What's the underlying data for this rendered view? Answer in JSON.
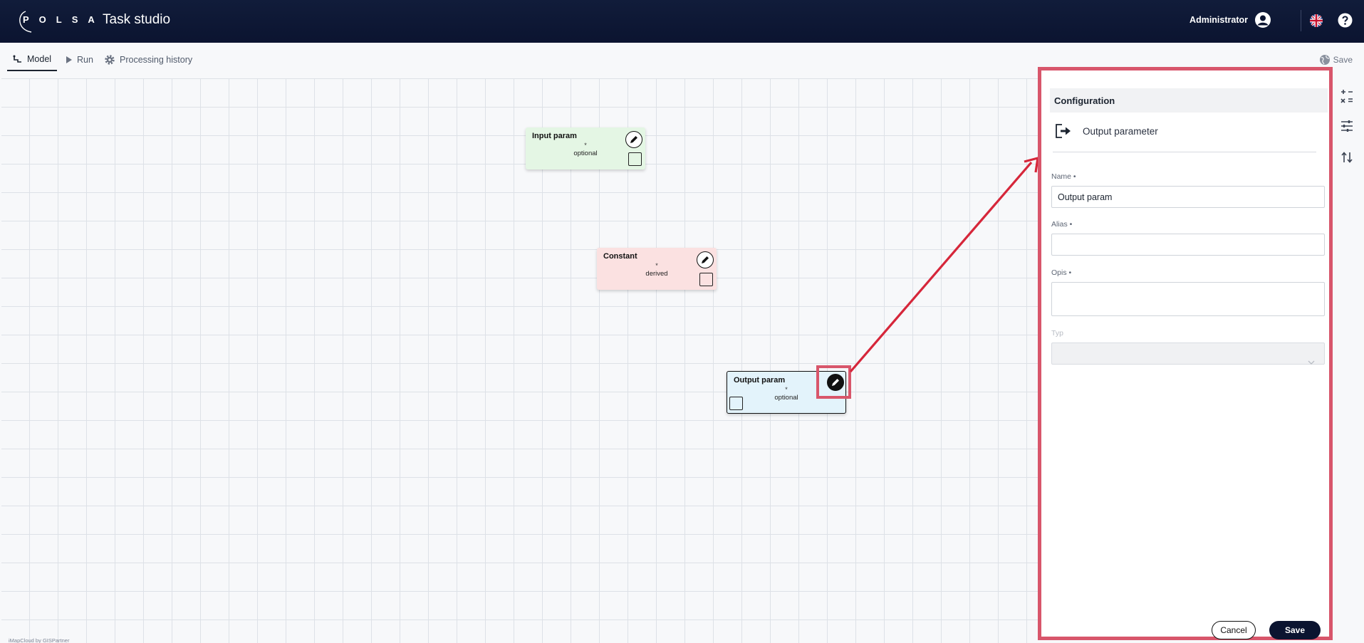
{
  "header": {
    "logo_text": "POLSA",
    "app_title": "Task studio",
    "user_name": "Administrator",
    "user_icon": "account-circle-icon",
    "language_icon": "uk-flag-icon",
    "help_icon": "help-icon"
  },
  "toolbar": {
    "tabs": [
      {
        "label": "Model",
        "icon": "flow-icon",
        "active": true
      },
      {
        "label": "Run",
        "icon": "play-icon",
        "active": false
      },
      {
        "label": "Processing history",
        "icon": "gear-icon",
        "active": false
      }
    ],
    "save_label": "Save",
    "save_icon": "globe-icon"
  },
  "canvas": {
    "nodes": [
      {
        "title": "Input param",
        "marker": "*",
        "subtitle": "optional",
        "color": "#e4f6e4"
      },
      {
        "title": "Constant",
        "marker": "*",
        "subtitle": "derived",
        "color": "#fbe1e1"
      },
      {
        "title": "Output param",
        "marker": "*",
        "subtitle": "optional",
        "color": "#e3f3fb"
      }
    ],
    "footer_credit": "iMapCloud by GISPartner"
  },
  "panel": {
    "header": "Configuration",
    "type_label": "Output parameter",
    "type_icon": "output-icon",
    "fields": {
      "name": {
        "label": "Name •",
        "value": "Output param"
      },
      "alias": {
        "label": "Alias •",
        "value": ""
      },
      "opis": {
        "label": "Opis •",
        "value": ""
      },
      "typ": {
        "label": "Typ",
        "value": ""
      }
    },
    "cancel_label": "Cancel",
    "save_label": "Save"
  },
  "side_tools": [
    "calculator-icon",
    "sliders-icon",
    "sort-arrows-icon"
  ],
  "colors": {
    "header_bg": "#0b1430",
    "highlight": "#d8566b",
    "arrow": "#d6263a",
    "accent": "#0b1430"
  }
}
